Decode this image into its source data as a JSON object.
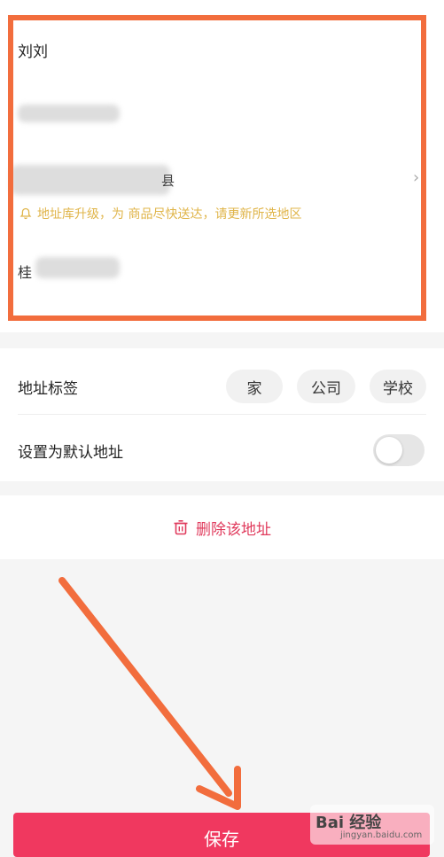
{
  "address": {
    "name": "刘刘",
    "city_tail": "县",
    "tip": "地址库升级，为  商品尽快送达，请更新所选地区",
    "detail_prefix": "桂"
  },
  "options": {
    "tag_label": "地址标签",
    "tags": [
      "家",
      "公司",
      "学校"
    ],
    "default_label": "设置为默认地址",
    "default_on": false
  },
  "delete_label": "删除该地址",
  "save_label": "保存",
  "watermark": {
    "main": "Bai 经验",
    "sub": "jingyan.baidu.com"
  },
  "colors": {
    "highlight": "#f26d3d",
    "accent": "#f0385f",
    "tip": "#e0b54a"
  }
}
